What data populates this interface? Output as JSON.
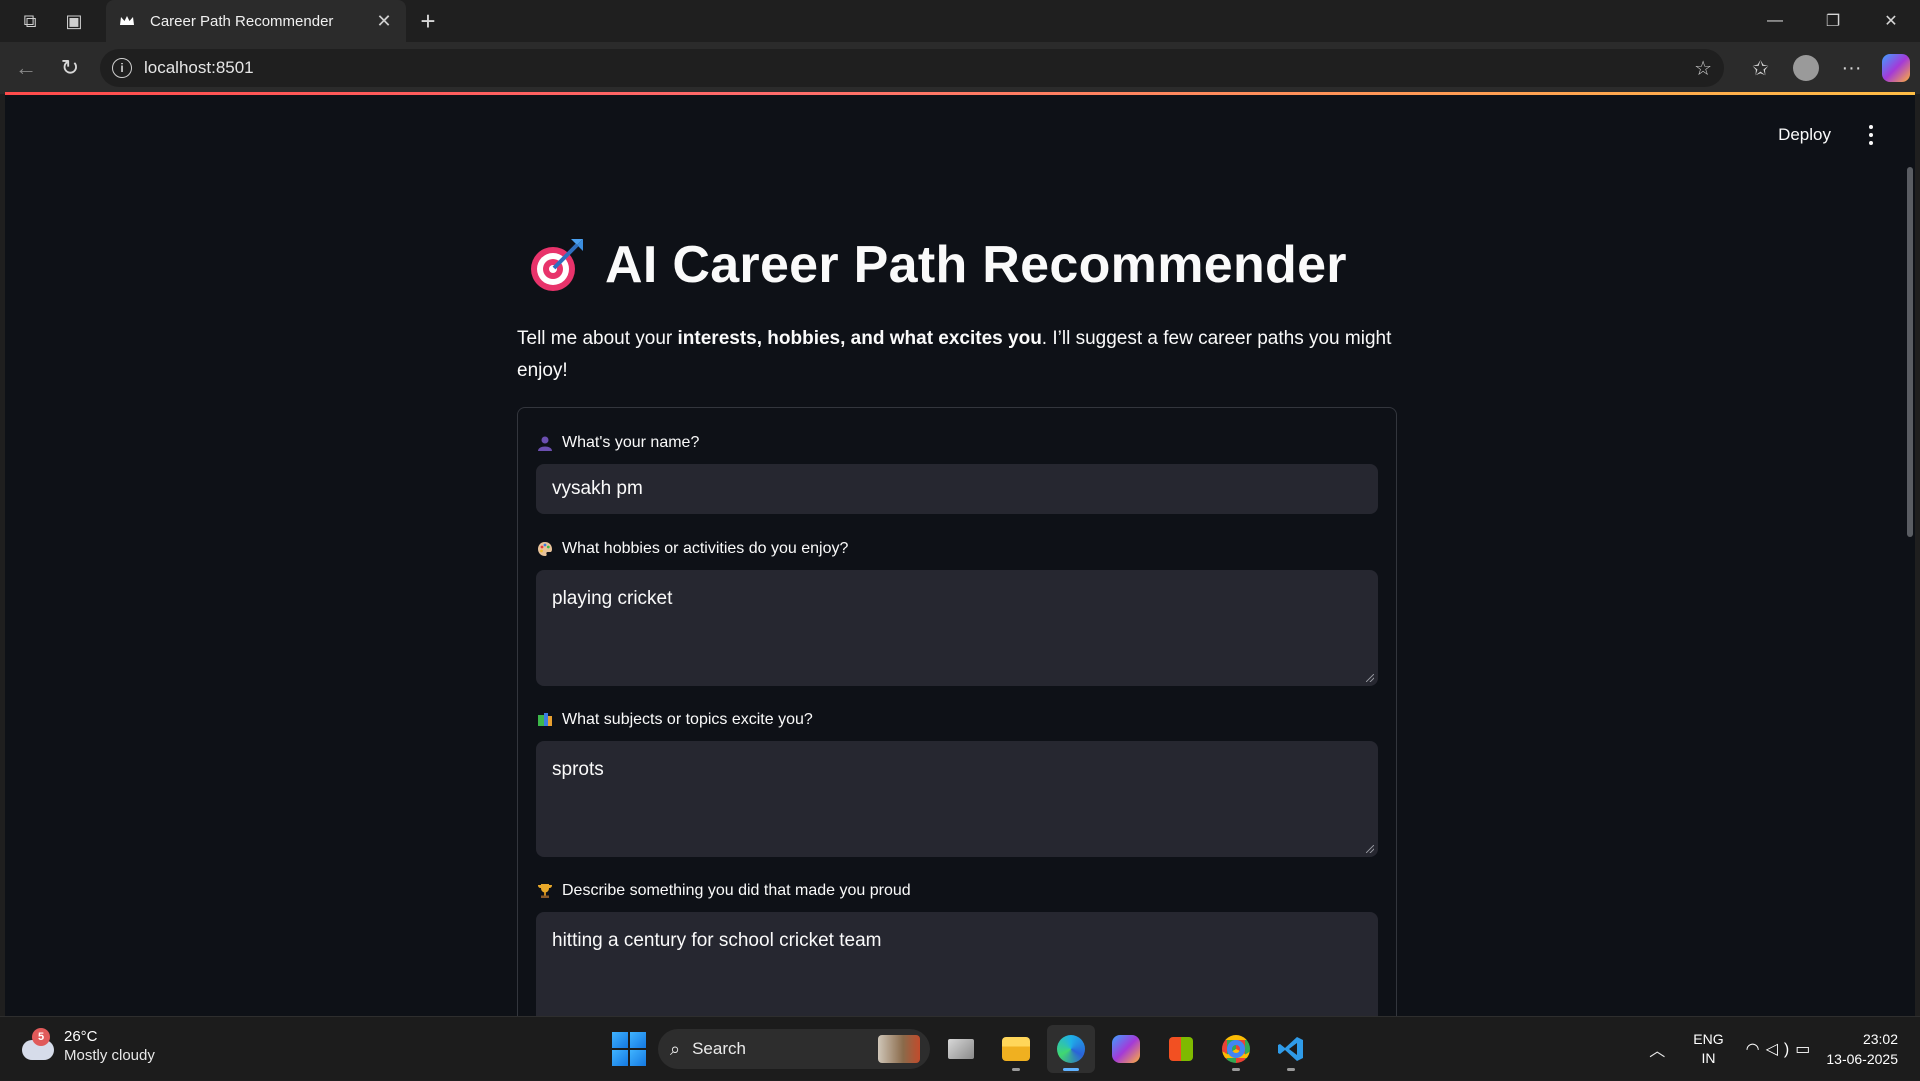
{
  "browser": {
    "tab_title": "Career Path Recommender",
    "url": "localhost:8501"
  },
  "app": {
    "deploy_label": "Deploy",
    "title": "AI Career Path Recommender",
    "intro": {
      "prefix": "Tell me about your ",
      "bold": "interests, hobbies, and what excites you",
      "suffix": ". I’ll suggest a few career paths you might enjoy!"
    },
    "fields": [
      {
        "icon": "person-icon",
        "label": "What's your name?",
        "value": "vysakh pm"
      },
      {
        "icon": "palette-icon",
        "label": "What hobbies or activities do you enjoy?",
        "value": "playing cricket"
      },
      {
        "icon": "books-icon",
        "label": "What subjects or topics excite you?",
        "value": "sprots"
      },
      {
        "icon": "trophy-icon",
        "label": "Describe something you did that made you proud",
        "value": "hitting a century for school cricket team"
      }
    ]
  },
  "taskbar": {
    "weather_badge": "5",
    "temperature": "26°C",
    "weather_desc": "Mostly cloudy",
    "search_label": "Search",
    "lang_line1": "ENG",
    "lang_line2": "IN",
    "time": "23:02",
    "date": "13-06-2025"
  },
  "colors": {
    "page_bg": "#0e1117",
    "input_bg": "#262730",
    "accent": "#ff4b4b"
  }
}
